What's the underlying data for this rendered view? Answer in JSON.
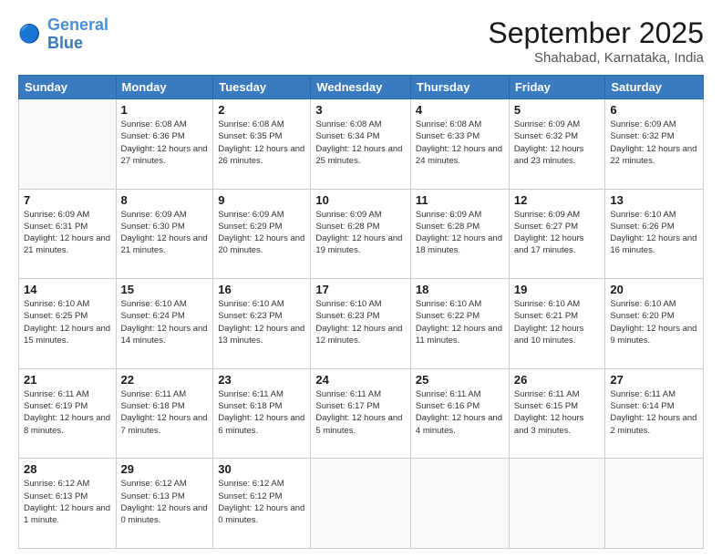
{
  "header": {
    "logo_general": "General",
    "logo_blue": "Blue",
    "month": "September 2025",
    "location": "Shahabad, Karnataka, India"
  },
  "weekdays": [
    "Sunday",
    "Monday",
    "Tuesday",
    "Wednesday",
    "Thursday",
    "Friday",
    "Saturday"
  ],
  "weeks": [
    [
      {
        "day": "",
        "sunrise": "",
        "sunset": "",
        "daylight": ""
      },
      {
        "day": "1",
        "sunrise": "Sunrise: 6:08 AM",
        "sunset": "Sunset: 6:36 PM",
        "daylight": "Daylight: 12 hours and 27 minutes."
      },
      {
        "day": "2",
        "sunrise": "Sunrise: 6:08 AM",
        "sunset": "Sunset: 6:35 PM",
        "daylight": "Daylight: 12 hours and 26 minutes."
      },
      {
        "day": "3",
        "sunrise": "Sunrise: 6:08 AM",
        "sunset": "Sunset: 6:34 PM",
        "daylight": "Daylight: 12 hours and 25 minutes."
      },
      {
        "day": "4",
        "sunrise": "Sunrise: 6:08 AM",
        "sunset": "Sunset: 6:33 PM",
        "daylight": "Daylight: 12 hours and 24 minutes."
      },
      {
        "day": "5",
        "sunrise": "Sunrise: 6:09 AM",
        "sunset": "Sunset: 6:32 PM",
        "daylight": "Daylight: 12 hours and 23 minutes."
      },
      {
        "day": "6",
        "sunrise": "Sunrise: 6:09 AM",
        "sunset": "Sunset: 6:32 PM",
        "daylight": "Daylight: 12 hours and 22 minutes."
      }
    ],
    [
      {
        "day": "7",
        "sunrise": "Sunrise: 6:09 AM",
        "sunset": "Sunset: 6:31 PM",
        "daylight": "Daylight: 12 hours and 21 minutes."
      },
      {
        "day": "8",
        "sunrise": "Sunrise: 6:09 AM",
        "sunset": "Sunset: 6:30 PM",
        "daylight": "Daylight: 12 hours and 21 minutes."
      },
      {
        "day": "9",
        "sunrise": "Sunrise: 6:09 AM",
        "sunset": "Sunset: 6:29 PM",
        "daylight": "Daylight: 12 hours and 20 minutes."
      },
      {
        "day": "10",
        "sunrise": "Sunrise: 6:09 AM",
        "sunset": "Sunset: 6:28 PM",
        "daylight": "Daylight: 12 hours and 19 minutes."
      },
      {
        "day": "11",
        "sunrise": "Sunrise: 6:09 AM",
        "sunset": "Sunset: 6:28 PM",
        "daylight": "Daylight: 12 hours and 18 minutes."
      },
      {
        "day": "12",
        "sunrise": "Sunrise: 6:09 AM",
        "sunset": "Sunset: 6:27 PM",
        "daylight": "Daylight: 12 hours and 17 minutes."
      },
      {
        "day": "13",
        "sunrise": "Sunrise: 6:10 AM",
        "sunset": "Sunset: 6:26 PM",
        "daylight": "Daylight: 12 hours and 16 minutes."
      }
    ],
    [
      {
        "day": "14",
        "sunrise": "Sunrise: 6:10 AM",
        "sunset": "Sunset: 6:25 PM",
        "daylight": "Daylight: 12 hours and 15 minutes."
      },
      {
        "day": "15",
        "sunrise": "Sunrise: 6:10 AM",
        "sunset": "Sunset: 6:24 PM",
        "daylight": "Daylight: 12 hours and 14 minutes."
      },
      {
        "day": "16",
        "sunrise": "Sunrise: 6:10 AM",
        "sunset": "Sunset: 6:23 PM",
        "daylight": "Daylight: 12 hours and 13 minutes."
      },
      {
        "day": "17",
        "sunrise": "Sunrise: 6:10 AM",
        "sunset": "Sunset: 6:23 PM",
        "daylight": "Daylight: 12 hours and 12 minutes."
      },
      {
        "day": "18",
        "sunrise": "Sunrise: 6:10 AM",
        "sunset": "Sunset: 6:22 PM",
        "daylight": "Daylight: 12 hours and 11 minutes."
      },
      {
        "day": "19",
        "sunrise": "Sunrise: 6:10 AM",
        "sunset": "Sunset: 6:21 PM",
        "daylight": "Daylight: 12 hours and 10 minutes."
      },
      {
        "day": "20",
        "sunrise": "Sunrise: 6:10 AM",
        "sunset": "Sunset: 6:20 PM",
        "daylight": "Daylight: 12 hours and 9 minutes."
      }
    ],
    [
      {
        "day": "21",
        "sunrise": "Sunrise: 6:11 AM",
        "sunset": "Sunset: 6:19 PM",
        "daylight": "Daylight: 12 hours and 8 minutes."
      },
      {
        "day": "22",
        "sunrise": "Sunrise: 6:11 AM",
        "sunset": "Sunset: 6:18 PM",
        "daylight": "Daylight: 12 hours and 7 minutes."
      },
      {
        "day": "23",
        "sunrise": "Sunrise: 6:11 AM",
        "sunset": "Sunset: 6:18 PM",
        "daylight": "Daylight: 12 hours and 6 minutes."
      },
      {
        "day": "24",
        "sunrise": "Sunrise: 6:11 AM",
        "sunset": "Sunset: 6:17 PM",
        "daylight": "Daylight: 12 hours and 5 minutes."
      },
      {
        "day": "25",
        "sunrise": "Sunrise: 6:11 AM",
        "sunset": "Sunset: 6:16 PM",
        "daylight": "Daylight: 12 hours and 4 minutes."
      },
      {
        "day": "26",
        "sunrise": "Sunrise: 6:11 AM",
        "sunset": "Sunset: 6:15 PM",
        "daylight": "Daylight: 12 hours and 3 minutes."
      },
      {
        "day": "27",
        "sunrise": "Sunrise: 6:11 AM",
        "sunset": "Sunset: 6:14 PM",
        "daylight": "Daylight: 12 hours and 2 minutes."
      }
    ],
    [
      {
        "day": "28",
        "sunrise": "Sunrise: 6:12 AM",
        "sunset": "Sunset: 6:13 PM",
        "daylight": "Daylight: 12 hours and 1 minute."
      },
      {
        "day": "29",
        "sunrise": "Sunrise: 6:12 AM",
        "sunset": "Sunset: 6:13 PM",
        "daylight": "Daylight: 12 hours and 0 minutes."
      },
      {
        "day": "30",
        "sunrise": "Sunrise: 6:12 AM",
        "sunset": "Sunset: 6:12 PM",
        "daylight": "Daylight: 12 hours and 0 minutes."
      },
      {
        "day": "",
        "sunrise": "",
        "sunset": "",
        "daylight": ""
      },
      {
        "day": "",
        "sunrise": "",
        "sunset": "",
        "daylight": ""
      },
      {
        "day": "",
        "sunrise": "",
        "sunset": "",
        "daylight": ""
      },
      {
        "day": "",
        "sunrise": "",
        "sunset": "",
        "daylight": ""
      }
    ]
  ]
}
